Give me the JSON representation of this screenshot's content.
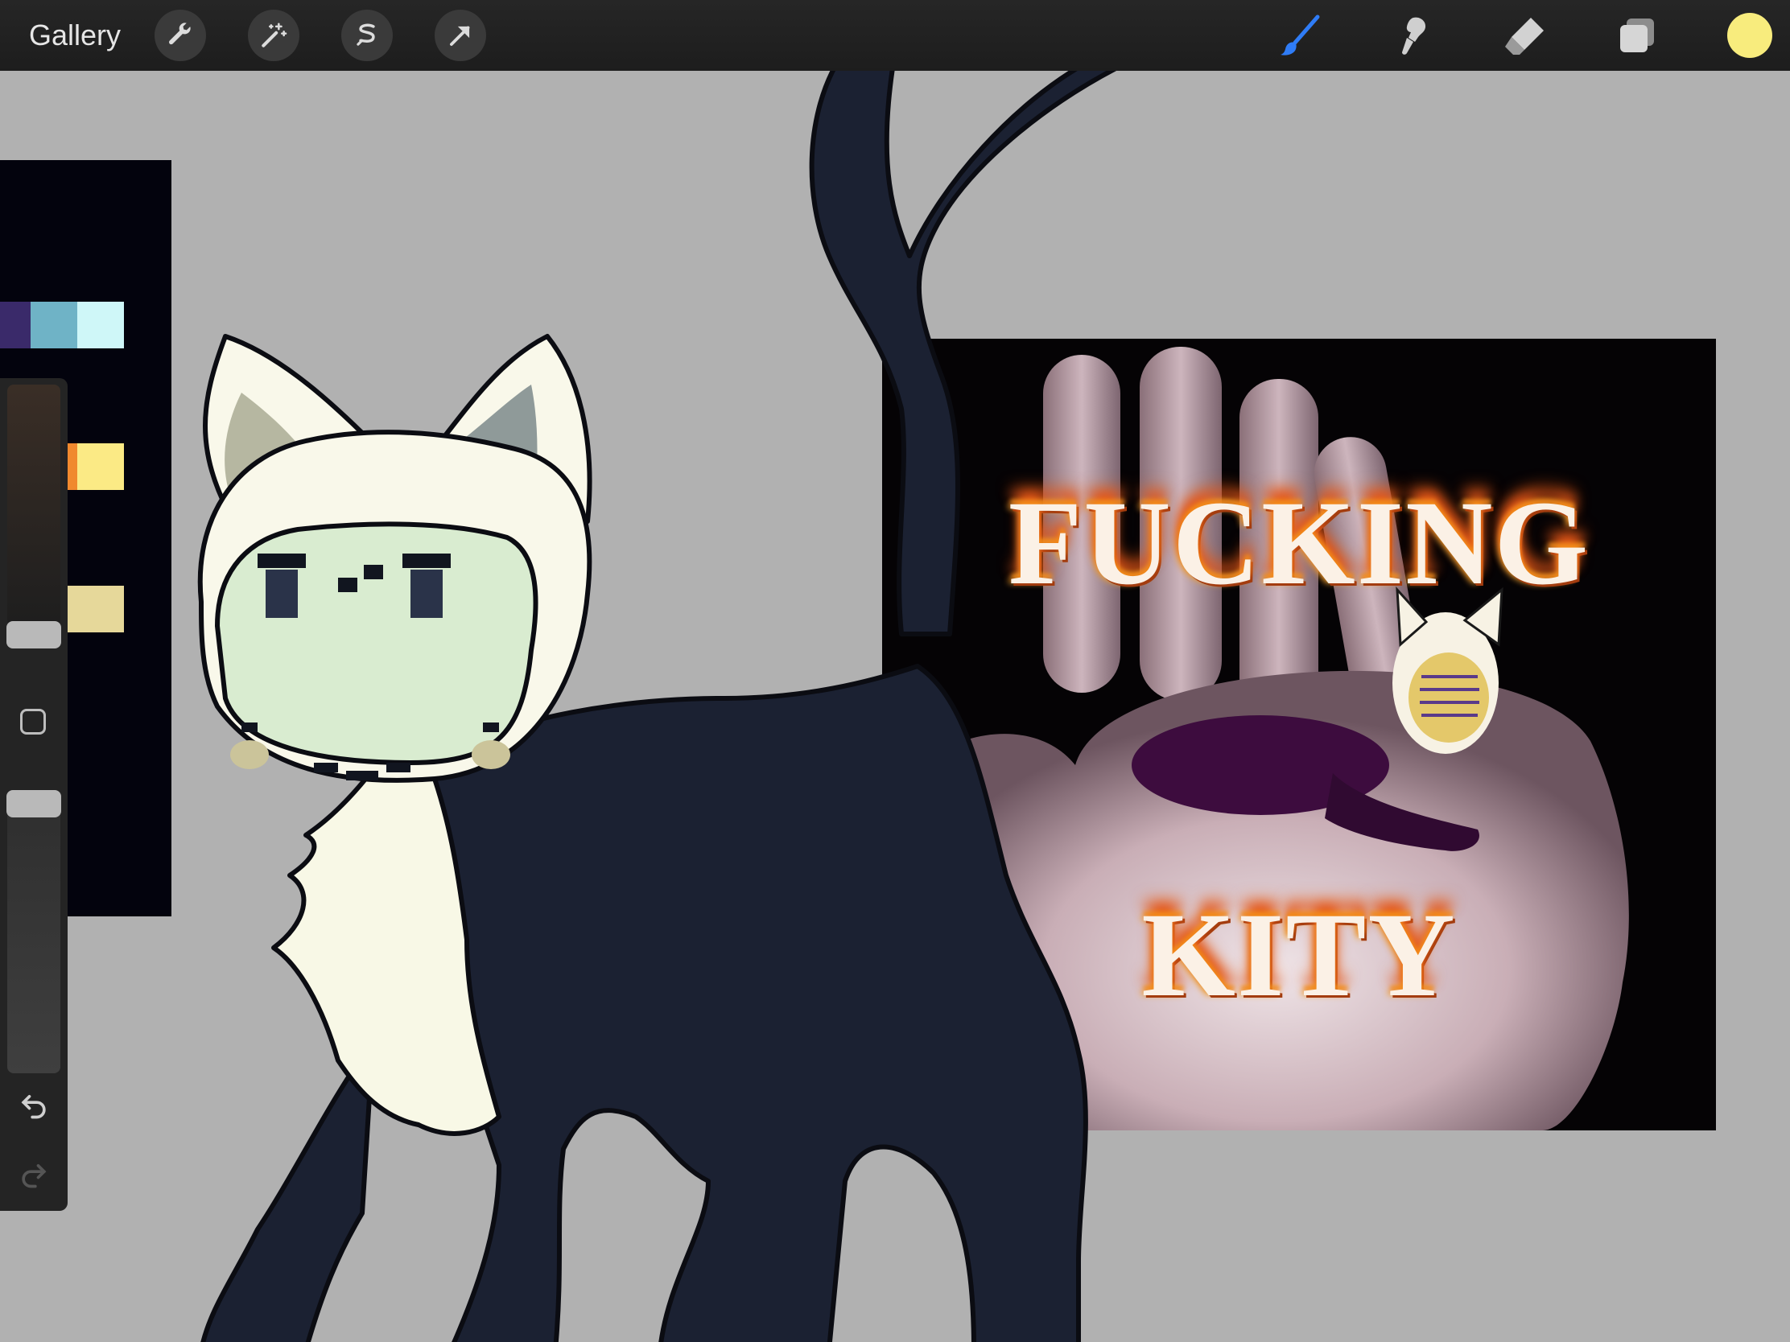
{
  "toolbar": {
    "gallery_label": "Gallery",
    "left_tools": [
      "wrench-icon",
      "magic-wand-icon",
      "selection-icon",
      "transform-arrow-icon"
    ],
    "right_tools": [
      "brush-icon",
      "smudge-icon",
      "eraser-icon",
      "layers-icon"
    ],
    "active_tool": "brush-icon",
    "active_color": "#f8ec7d",
    "accent": "#2f7cf6"
  },
  "reference_palette": {
    "swatches": [
      "#3a2a6a",
      "#6fb3c6",
      "#cff7f8",
      "#5d2b7d",
      "#f0892e",
      "#fbea85",
      "#e6d89a"
    ]
  },
  "photo_reference": {
    "line1": "FUCKING",
    "line2": "KITY"
  }
}
